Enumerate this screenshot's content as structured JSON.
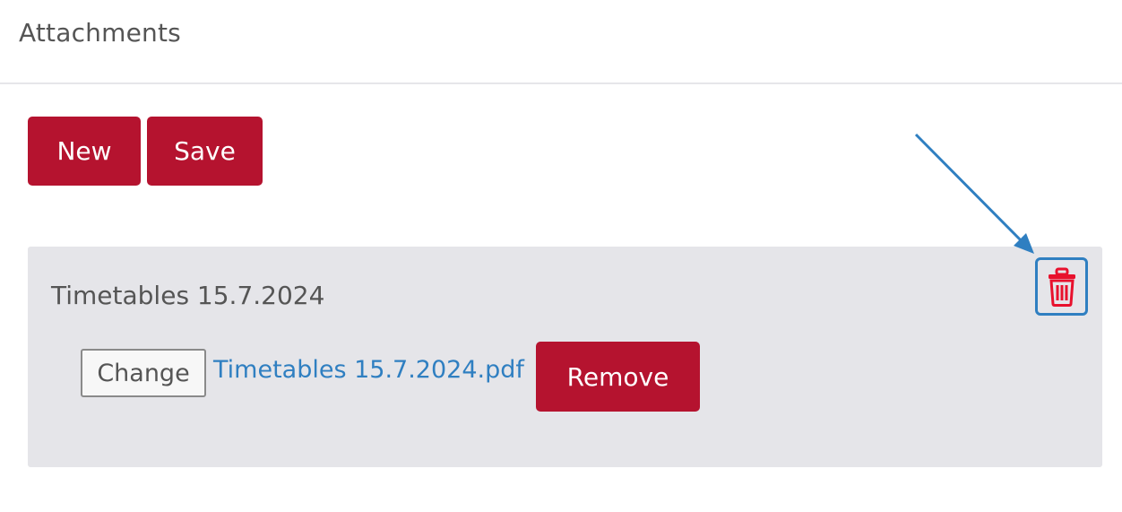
{
  "header": {
    "title": "Attachments"
  },
  "toolbar": {
    "new_label": "New",
    "save_label": "Save"
  },
  "attachment": {
    "title": "Timetables 15.7.2024",
    "change_label": "Change",
    "file_name": "Timetables 15.7.2024.pdf",
    "remove_label": "Remove",
    "delete_icon": "trash-icon"
  },
  "colors": {
    "accent": "#b5132f",
    "link": "#2f7fc1",
    "panel_bg": "#e5e5e9",
    "delete_icon": "#e8112d",
    "annotation": "#2f7fc1"
  }
}
